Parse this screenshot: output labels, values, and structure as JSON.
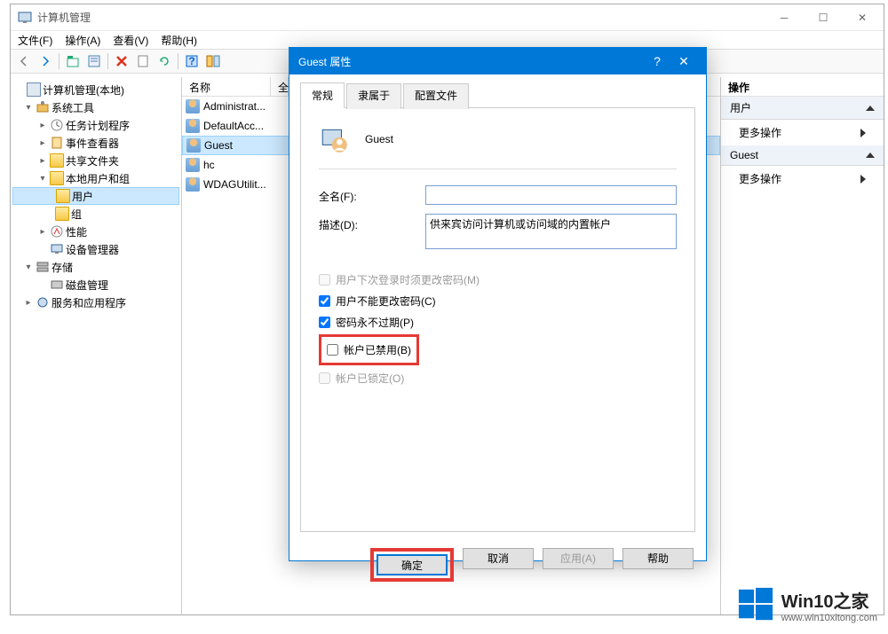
{
  "window": {
    "title": "计算机管理",
    "menus": [
      "文件(F)",
      "操作(A)",
      "查看(V)",
      "帮助(H)"
    ]
  },
  "tree": {
    "root": "计算机管理(本地)",
    "n_systools": "系统工具",
    "n_task": "任务计划程序",
    "n_event": "事件查看器",
    "n_share": "共享文件夹",
    "n_localusers": "本地用户和组",
    "n_users": "用户",
    "n_groups": "组",
    "n_perf": "性能",
    "n_device": "设备管理器",
    "n_storage": "存储",
    "n_disk": "磁盘管理",
    "n_services": "服务和应用程序"
  },
  "list": {
    "col_name": "名称",
    "col_full": "全",
    "rows": [
      "Administrat...",
      "DefaultAcc...",
      "Guest",
      "hc",
      "WDAGUtilit..."
    ]
  },
  "actions": {
    "header": "操作",
    "section1": "用户",
    "item1": "更多操作",
    "section2": "Guest",
    "item2": "更多操作"
  },
  "dialog": {
    "title": "Guest 属性",
    "tabs": [
      "常规",
      "隶属于",
      "配置文件"
    ],
    "username": "Guest",
    "label_fullname": "全名(F):",
    "fullname_value": "",
    "label_desc": "描述(D):",
    "desc_value": "供来宾访问计算机或访问域的内置帐户",
    "chk_mustchange": "用户下次登录时须更改密码(M)",
    "chk_cannotchange": "用户不能更改密码(C)",
    "chk_neverexpire": "密码永不过期(P)",
    "chk_disabled": "帐户已禁用(B)",
    "chk_locked": "帐户已锁定(O)",
    "btn_ok": "确定",
    "btn_cancel": "取消",
    "btn_apply": "应用(A)",
    "btn_help": "帮助"
  },
  "watermark": {
    "brand": "Win10之家",
    "url": "www.win10xitong.com"
  }
}
